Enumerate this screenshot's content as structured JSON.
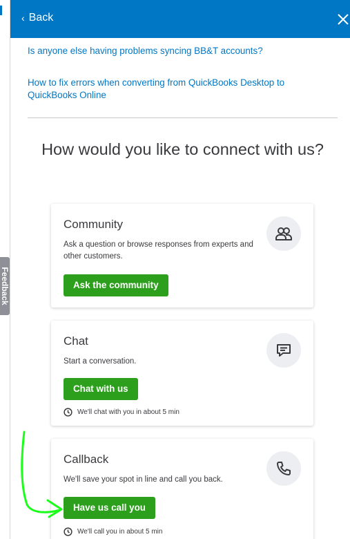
{
  "header": {
    "back_label": "Back",
    "close_icon": "close-icon"
  },
  "feedback_tab": {
    "label": "Feedback"
  },
  "articles": [
    {
      "title": "Is anyone else having problems syncing BB&T accounts?"
    },
    {
      "title": "How to fix errors when converting from QuickBooks Desktop to QuickBooks Online"
    }
  ],
  "connect": {
    "title": "How would you like to connect with us?"
  },
  "options": {
    "community": {
      "title": "Community",
      "description": "Ask a question or browse responses from experts and other customers.",
      "button": "Ask the community",
      "icon": "community-people-icon"
    },
    "chat": {
      "title": "Chat",
      "description": "Start a conversation.",
      "button": "Chat with us",
      "wait": "We'll chat with you in about 5 min",
      "icon": "chat-bubble-icon"
    },
    "callback": {
      "title": "Callback",
      "description": "We'll save your spot in line and call you back.",
      "button": "Have us call you",
      "wait": "We'll call you in about 5 min",
      "icon": "phone-icon"
    }
  },
  "colors": {
    "header_blue": "#0077c5",
    "button_green": "#2ca01c",
    "annotation_green": "#1aff1a"
  }
}
